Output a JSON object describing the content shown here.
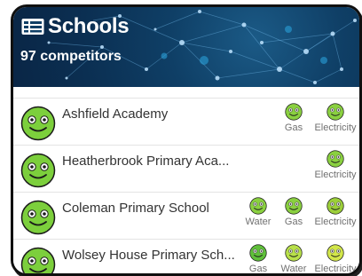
{
  "header": {
    "title": "Schools",
    "icon": "list-card-icon",
    "subtitle": "97 competitors",
    "background_color": "#0f3f66"
  },
  "schools": [
    {
      "name": "Ashfield Academy",
      "fuels": [
        {
          "label": "Gas",
          "color": "#8ad040"
        },
        {
          "label": "Electricity",
          "color": "#8ad040"
        }
      ]
    },
    {
      "name": "Heatherbrook Primary Aca...",
      "fuels": [
        {
          "label": "Electricity",
          "color": "#8ad040"
        }
      ]
    },
    {
      "name": "Coleman Primary School",
      "fuels": [
        {
          "label": "Water",
          "color": "#8ad040"
        },
        {
          "label": "Gas",
          "color": "#8ad040"
        },
        {
          "label": "Electricity",
          "color": "#9ccf3a"
        }
      ]
    },
    {
      "name": "Wolsey House Primary Sch...",
      "fuels": [
        {
          "label": "Gas",
          "color": "#5fbf3a"
        },
        {
          "label": "Water",
          "color": "#b8e04a"
        },
        {
          "label": "Electricity",
          "color": "#d2e64a"
        }
      ]
    }
  ],
  "colors": {
    "avatar_green": "#7ccf3c",
    "text": "#333333",
    "muted": "#707070"
  }
}
